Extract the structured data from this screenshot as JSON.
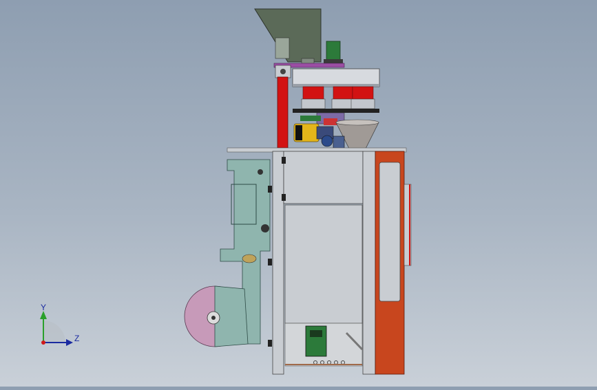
{
  "view": {
    "background_top": "#8e9eb1",
    "background_bottom": "#c9d0d8"
  },
  "triad": {
    "y_label": "Y",
    "z_label": "Z",
    "y_color": "#2aa02a",
    "z_color": "#1a2aa0",
    "origin_color": "#d01a1a"
  },
  "model": {
    "frame_color": "#c9cdd2",
    "side_panel_color": "#8fb5ae",
    "accent_red": "#d21212",
    "door_color": "#c8461e",
    "film_roll_color": "#c79ab9",
    "hopper_color": "#5b6a58",
    "motor_color": "#2c7a3a"
  }
}
